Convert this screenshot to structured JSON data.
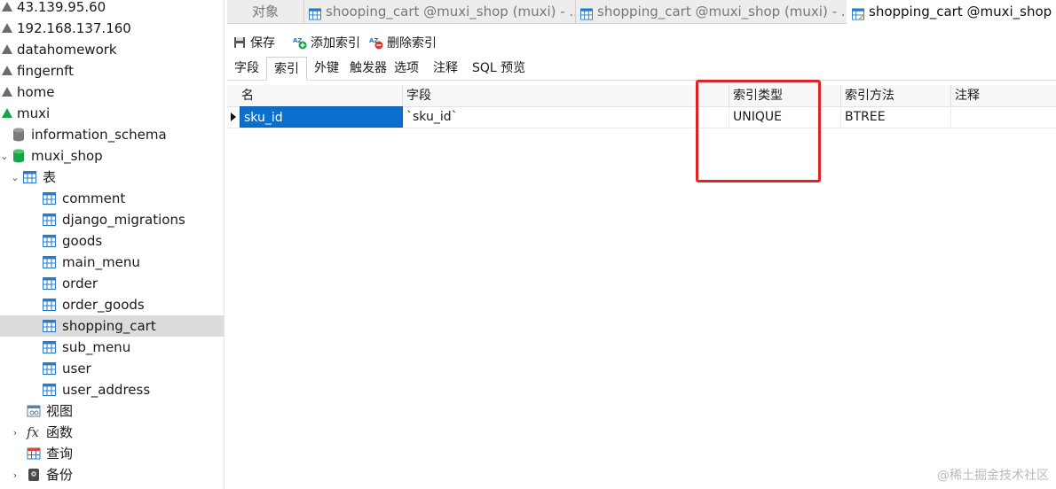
{
  "sidebar": {
    "connections": [
      {
        "label": "43.139.95.60"
      },
      {
        "label": "192.168.137.160"
      },
      {
        "label": "datahomework"
      },
      {
        "label": "fingernft"
      },
      {
        "label": "home"
      },
      {
        "label": "muxi"
      }
    ],
    "databases": [
      {
        "label": "information_schema"
      },
      {
        "label": "muxi_shop"
      }
    ],
    "tables_group": {
      "label": "表"
    },
    "tables": [
      {
        "label": "comment"
      },
      {
        "label": "django_migrations"
      },
      {
        "label": "goods"
      },
      {
        "label": "main_menu"
      },
      {
        "label": "order"
      },
      {
        "label": "order_goods"
      },
      {
        "label": "shopping_cart",
        "selected": true
      },
      {
        "label": "sub_menu"
      },
      {
        "label": "user"
      },
      {
        "label": "user_address"
      }
    ],
    "groups": [
      {
        "label": "视图",
        "icon": "view-icon"
      },
      {
        "label": "函数",
        "icon": "function-icon"
      },
      {
        "label": "查询",
        "icon": "query-icon"
      },
      {
        "label": "备份",
        "icon": "backup-icon"
      }
    ]
  },
  "doc_tabs": [
    {
      "label": "对象"
    },
    {
      "label": "shooping_cart @muxi_shop (muxi) - ..."
    },
    {
      "label": "shopping_cart @muxi_shop (muxi) - ..."
    },
    {
      "label": "shopping_cart @muxi_shop ("
    }
  ],
  "toolbar": {
    "save_label": "保存",
    "add_index_label": "添加索引",
    "delete_index_label": "删除索引"
  },
  "subtabs": [
    {
      "label": "字段"
    },
    {
      "label": "索引",
      "active": true
    },
    {
      "label": "外键"
    },
    {
      "label": "触发器"
    },
    {
      "label": "选项"
    },
    {
      "label": "注释"
    },
    {
      "label": "SQL 预览"
    }
  ],
  "grid": {
    "headers": {
      "name": "名",
      "fields": "字段",
      "index_type": "索引类型",
      "index_method": "索引方法",
      "comment": "注释"
    },
    "rows": [
      {
        "name": "sku_id",
        "fields": "`sku_id`",
        "index_type": "UNIQUE",
        "index_method": "BTREE",
        "comment": ""
      }
    ]
  },
  "watermark": "@稀土掘金技术社区",
  "colors": {
    "highlight_box": "#e02424",
    "selection": "#0b6fce",
    "db_green": "#19a34a"
  }
}
